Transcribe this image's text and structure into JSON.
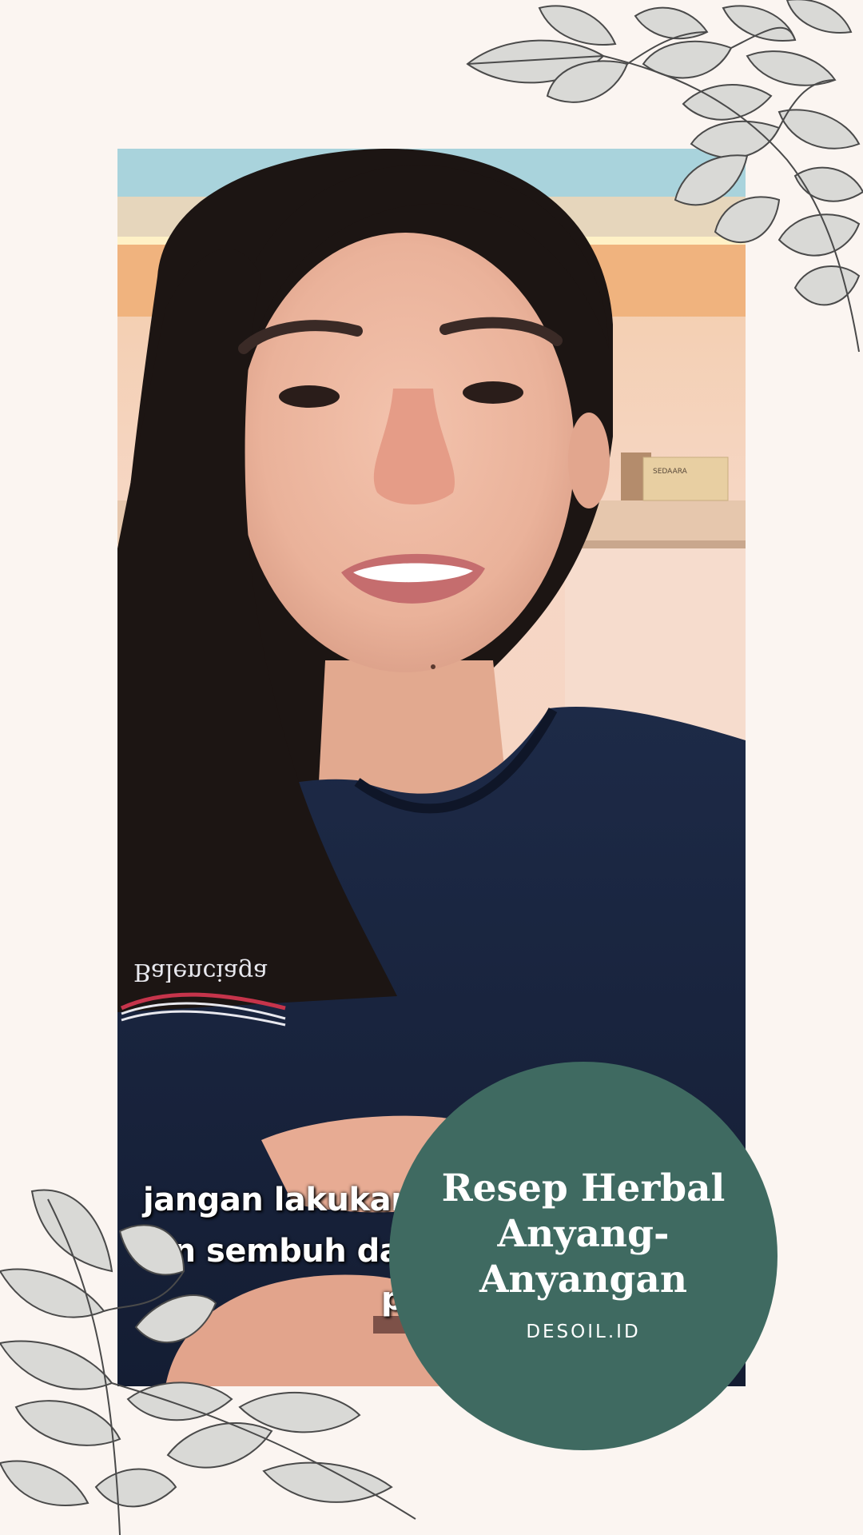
{
  "badge": {
    "title": "Resep Herbal Anyang-Anyangan",
    "subtitle": "DESOIL.ID"
  },
  "caption": {
    "line1": "jangan lakukan",
    "line2_prefix": "i",
    "line2": "jin sembuh da",
    "line3": "p"
  },
  "shirt_logo": "Balenciaga",
  "shelf_box_label": "SEDAARA",
  "colors": {
    "background": "#fbf5f1",
    "badge": "#3f6a61",
    "shirt": "#1a2540",
    "hair": "#1c1513",
    "wall": "#f4d4c2",
    "leaf_line": "#4a4a4a",
    "leaf_fill": "#d9d9d6"
  }
}
